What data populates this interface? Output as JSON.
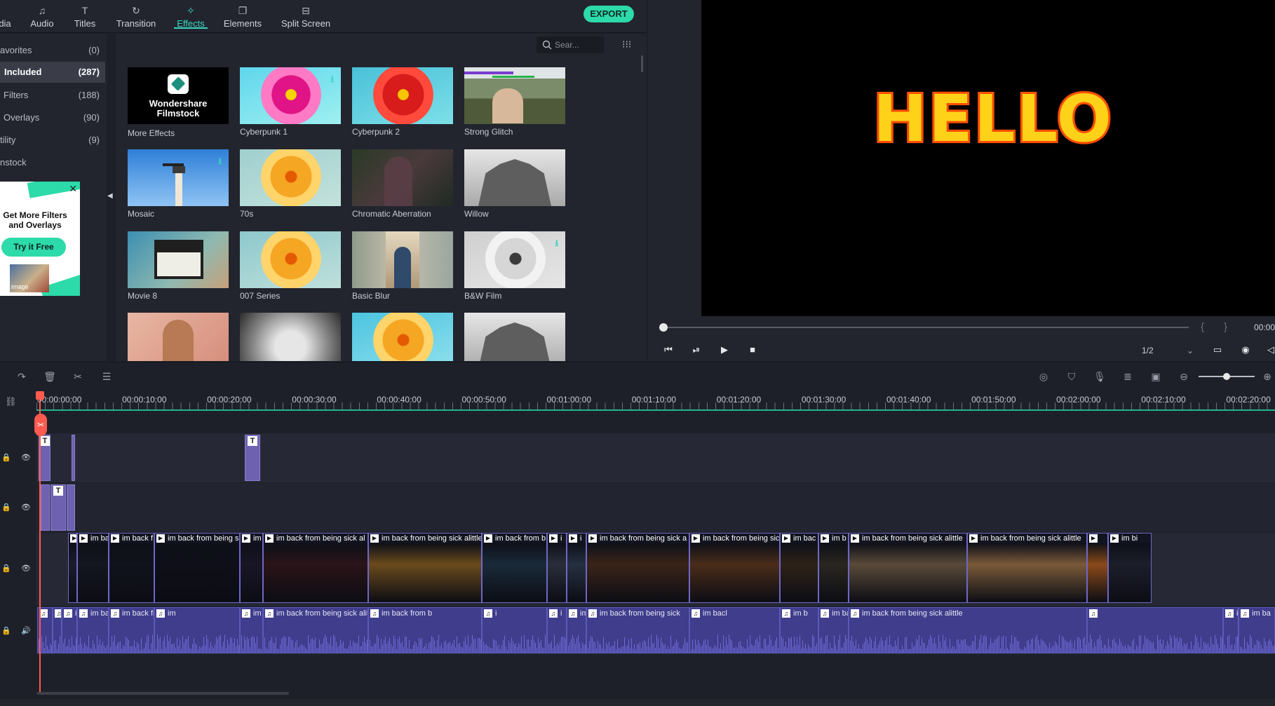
{
  "tabs": [
    {
      "label": "dia",
      "icon": "media-icon"
    },
    {
      "label": "Audio",
      "icon": "audio-icon"
    },
    {
      "label": "Titles",
      "icon": "titles-icon"
    },
    {
      "label": "Transition",
      "icon": "transition-icon"
    },
    {
      "label": "Effects",
      "icon": "effects-icon",
      "active": true
    },
    {
      "label": "Elements",
      "icon": "elements-icon"
    },
    {
      "label": "Split Screen",
      "icon": "split-screen-icon"
    }
  ],
  "export_label": "EXPORT",
  "categories": [
    {
      "label": "avorites",
      "count": "(0)"
    },
    {
      "label": "Included",
      "count": "(287)",
      "selected": true
    },
    {
      "label": "Filters",
      "count": "(188)"
    },
    {
      "label": "Overlays",
      "count": "(90)"
    },
    {
      "label": "tility",
      "count": "(9)"
    },
    {
      "label": "nstock",
      "count": ""
    }
  ],
  "ad": {
    "title": "Get More Filters and Overlays",
    "button": "Try it Free",
    "photo_label": "image"
  },
  "search": {
    "placeholder": "Sear..."
  },
  "effects": [
    {
      "name": "More Effects",
      "logo_line1": "Wondershare",
      "logo_line2": "Filmstock"
    },
    {
      "name": "Cyberpunk 1"
    },
    {
      "name": "Cyberpunk 2"
    },
    {
      "name": "Strong Glitch"
    },
    {
      "name": "Mosaic"
    },
    {
      "name": "70s"
    },
    {
      "name": "Chromatic Aberration"
    },
    {
      "name": "Willow"
    },
    {
      "name": "Movie 8"
    },
    {
      "name": "007 Series"
    },
    {
      "name": "Basic Blur"
    },
    {
      "name": "B&W Film"
    },
    {
      "name": ""
    },
    {
      "name": ""
    },
    {
      "name": ""
    },
    {
      "name": ""
    }
  ],
  "preview": {
    "text": "HELLO",
    "timecode": "00:00",
    "ratio": "1/2",
    "bracket_in": "{",
    "bracket_out": "}"
  },
  "ruler": [
    "00:00:00:00",
    "00:00:10:00",
    "00:00:20:00",
    "00:00:30:00",
    "00:00:40:00",
    "00:00:50:00",
    "00:01:00:00",
    "00:01:10:00",
    "00:01:20:00",
    "00:01:30:00",
    "00:01:40:00",
    "00:01:50:00",
    "00:02:00:00",
    "00:02:10:00",
    "00:02:20:00"
  ],
  "title_badge": "T",
  "video_clips": [
    "",
    "im ba",
    "im back f",
    "im back from being si",
    "im",
    "im back from being sick al",
    "im back from being sick alittle",
    "im back from b",
    "i",
    "i",
    "im back from being sick a",
    "im back from being sick",
    "im bac",
    "im b",
    "im back from being sick alittle",
    "im back from being sick alittle",
    "",
    "im bi"
  ],
  "audio_clips": [
    "",
    "i",
    "im ba",
    "im back",
    "im back from being si",
    "im",
    "im back from being sick alt",
    "im back from being sick alittle",
    "im back from b",
    "i",
    "i",
    "im back from being sick al",
    "im back from being sick",
    "im bacl",
    "im b",
    "im back from being sick alittle",
    "im back from being sick alittle",
    "",
    "ir",
    "im ba"
  ],
  "colors": {
    "accent": "#38d6c0",
    "export": "#2ddaa9",
    "playhead": "#ff5a4f",
    "title_clip": "#6e62b0",
    "audio_clip": "#3f3d8c"
  }
}
